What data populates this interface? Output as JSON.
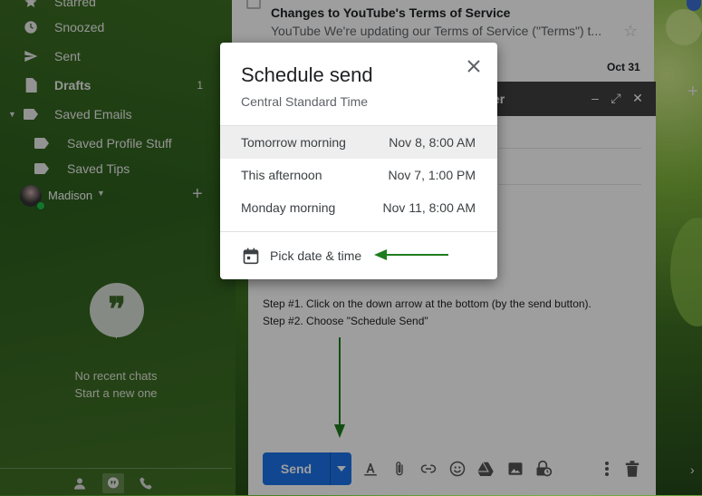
{
  "sidebar": {
    "nav": [
      {
        "label": "Starred",
        "icon": "star-icon",
        "count": ""
      },
      {
        "label": "Snoozed",
        "icon": "clock-icon",
        "count": ""
      },
      {
        "label": "Sent",
        "icon": "send-icon",
        "count": ""
      },
      {
        "label": "Drafts",
        "icon": "draft-icon",
        "count": "1"
      },
      {
        "label": "Saved Emails",
        "icon": "label-icon",
        "count": ""
      },
      {
        "label": "Saved Profile Stuff",
        "icon": "label-icon",
        "count": ""
      },
      {
        "label": "Saved Tips",
        "icon": "label-icon",
        "count": ""
      }
    ],
    "user_name": "Madison",
    "no_chats": "No recent chats",
    "start_new": "Start a new one",
    "bottom_icons": [
      "person-icon",
      "hangouts-icon",
      "phone-icon"
    ]
  },
  "email_list": {
    "subject": "Changes to YouTube's Terms of Service",
    "snippet": "YouTube We're updating our Terms of Service (\"Terms\") t...",
    "next_date": "Oct 31"
  },
  "compose": {
    "title_fragment": "er",
    "step1": "Step #1. Click on the down arrow at the bottom (by the send button).",
    "step2": "Step #2. Choose \"Schedule Send\"",
    "send_label": "Send",
    "toolbar_icons": [
      "format-text-icon",
      "attach-icon",
      "link-icon",
      "emoji-icon",
      "drive-icon",
      "photo-icon",
      "confidential-icon",
      "more-options-icon",
      "trash-icon"
    ]
  },
  "dialog": {
    "title": "Schedule send",
    "timezone": "Central Standard Time",
    "options": [
      {
        "label": "Tomorrow morning",
        "time": "Nov 8, 8:00 AM",
        "highlighted": true
      },
      {
        "label": "This afternoon",
        "time": "Nov 7, 1:00 PM",
        "highlighted": false
      },
      {
        "label": "Monday morning",
        "time": "Nov 11, 8:00 AM",
        "highlighted": false
      }
    ],
    "pick_label": "Pick date & time"
  },
  "colors": {
    "accent_blue": "#1a73e8",
    "arrow_green": "#1e7d1e",
    "compose_header": "#404040"
  }
}
